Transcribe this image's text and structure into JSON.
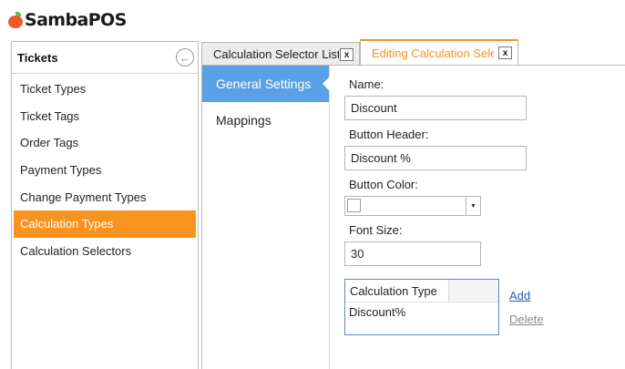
{
  "app": {
    "logo_text": "SambaPOS"
  },
  "sidebar": {
    "title": "Tickets",
    "items": [
      {
        "label": "Ticket Types"
      },
      {
        "label": "Ticket Tags"
      },
      {
        "label": "Order Tags"
      },
      {
        "label": "Payment Types"
      },
      {
        "label": "Change Payment Types"
      },
      {
        "label": "Calculation Types",
        "active": true
      },
      {
        "label": "Calculation Selectors"
      }
    ]
  },
  "tabs": [
    {
      "label": "Calculation Selector List",
      "close": "x"
    },
    {
      "label": "Editing Calculation Selector",
      "close": "x",
      "active": true
    }
  ],
  "subnav": {
    "items": [
      {
        "label": "General Settings",
        "active": true
      },
      {
        "label": "Mappings"
      }
    ]
  },
  "form": {
    "name_label": "Name:",
    "name_value": "Discount",
    "button_header_label": "Button Header:",
    "button_header_value": "Discount %",
    "button_color_label": "Button Color:",
    "font_size_label": "Font Size:",
    "font_size_value": "30"
  },
  "calc_grid": {
    "column": "Calculation Type",
    "rows": [
      "Discount%"
    ]
  },
  "actions": {
    "add": "Add",
    "delete": "Delete"
  },
  "colors": {
    "accent": "#f7931e",
    "selected_blue": "#5aa0e6",
    "link": "#1f5bbd",
    "logo_apple": "#f15a22"
  }
}
